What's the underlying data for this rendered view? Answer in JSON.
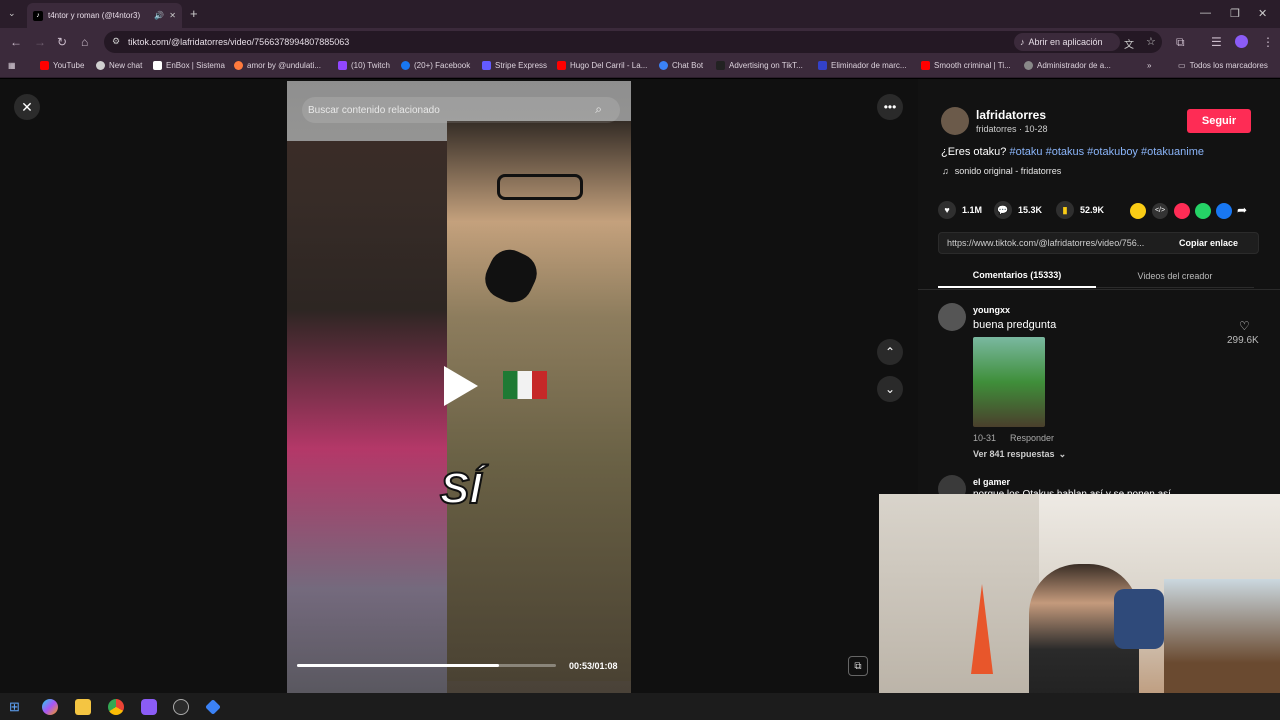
{
  "browser": {
    "tab_title": "t4ntor y roman (@t4ntor3)",
    "new_tab": "+",
    "url": "tiktok.com/@lafridatorres/video/7566378994807885063",
    "open_app": "Abrir en aplicación",
    "bookmarks": [
      {
        "label": "YouTube",
        "color": "#ff0000"
      },
      {
        "label": "New chat",
        "color": "#cfcfcf"
      },
      {
        "label": "EnBox | Sistema",
        "color": "#ffffff"
      },
      {
        "label": "amor by @undulati...",
        "color": "#ff7a3d"
      },
      {
        "label": "(10) Twitch",
        "color": "#9146ff"
      },
      {
        "label": "(20+) Facebook",
        "color": "#1877f2"
      },
      {
        "label": "Stripe Express",
        "color": "#635bff"
      },
      {
        "label": "Hugo Del Carril - La...",
        "color": "#ff0000"
      },
      {
        "label": "Chat Bot",
        "color": "#3b82f6"
      },
      {
        "label": "Advertising on TikT...",
        "color": "#222222"
      },
      {
        "label": "Eliminador de marc...",
        "color": "#3341c9"
      },
      {
        "label": "Smooth criminal | Ti...",
        "color": "#ff0000"
      },
      {
        "label": "Administrador de a...",
        "color": "#888888"
      }
    ],
    "all_bookmarks": "Todos los marcadores"
  },
  "video": {
    "search_placeholder": "Buscar contenido relacionado",
    "caption_overlay": "SÍ",
    "time": "00:53/01:08",
    "progress": 0.78
  },
  "creator": {
    "name": "lafridatorres",
    "sub": "fridatorres · 10-28",
    "follow": "Seguir",
    "description_text": "¿Eres otaku?",
    "hashtags": [
      "#otaku",
      "#otakus",
      "#otakuboy",
      "#otakuanime"
    ],
    "sound": "sonido original - fridatorres"
  },
  "stats": {
    "likes": "1.1M",
    "comments": "15.3K",
    "saves": "52.9K"
  },
  "link": {
    "url": "https://www.tiktok.com/@lafridatorres/video/756...",
    "copy": "Copiar enlace"
  },
  "tabs": {
    "comments": "Comentarios (15333)",
    "creator_videos": "Videos del creador"
  },
  "comments": [
    {
      "user": "youngxx",
      "text": "buena predgunta",
      "likes": "299.6K",
      "date": "10-31",
      "reply": "Responder",
      "view_replies": "Ver 841 respuestas"
    },
    {
      "user": "el gamer",
      "text": "porque los Otakus hablan así y se ponen así"
    }
  ],
  "colors": {
    "accent": "#fe2c55",
    "hashtag": "#8ab4f8"
  }
}
